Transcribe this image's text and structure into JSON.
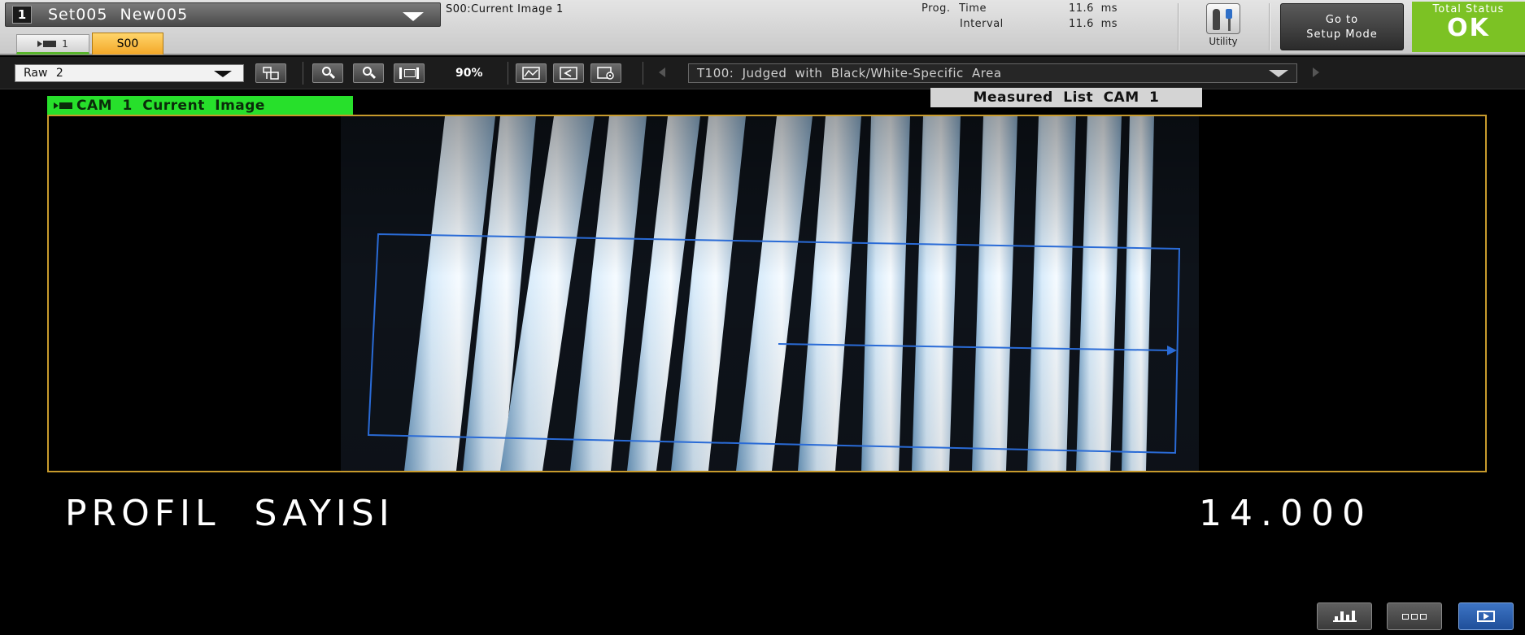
{
  "header": {
    "setting_number": "1",
    "setting_name": "Set005 New005",
    "image_label": "S00:Current Image 1",
    "prog_time_label": "Prog. Time",
    "prog_time_value": "11.6 ms",
    "interval_label": "Interval",
    "interval_value": "11.6 ms",
    "utility_label": "Utility",
    "setup_button_line1": "Go to",
    "setup_button_line2": "Setup Mode",
    "total_status_label": "Total Status",
    "total_status_value": "OK",
    "status_color": "#7cc224"
  },
  "tabs": {
    "camera_tab_label": "1",
    "scene_tab_label": "S00"
  },
  "toolbar": {
    "image_source": "Raw 2",
    "zoom_level": "90%",
    "tool_selection": "T100: Judged with Black/White-Specific Area"
  },
  "view": {
    "camera_label": "CAM 1 Current Image",
    "measured_list_label": "Measured List CAM 1",
    "frame_color": "#c79a2c",
    "label_color": "#27e02b"
  },
  "measurement": {
    "label": "PROFIL SAYISI",
    "value": "14.000"
  },
  "icons": {
    "utility": "tools-icon",
    "graph": "bar-graph-icon",
    "list": "list-view-icon",
    "run": "run-mode-icon"
  }
}
